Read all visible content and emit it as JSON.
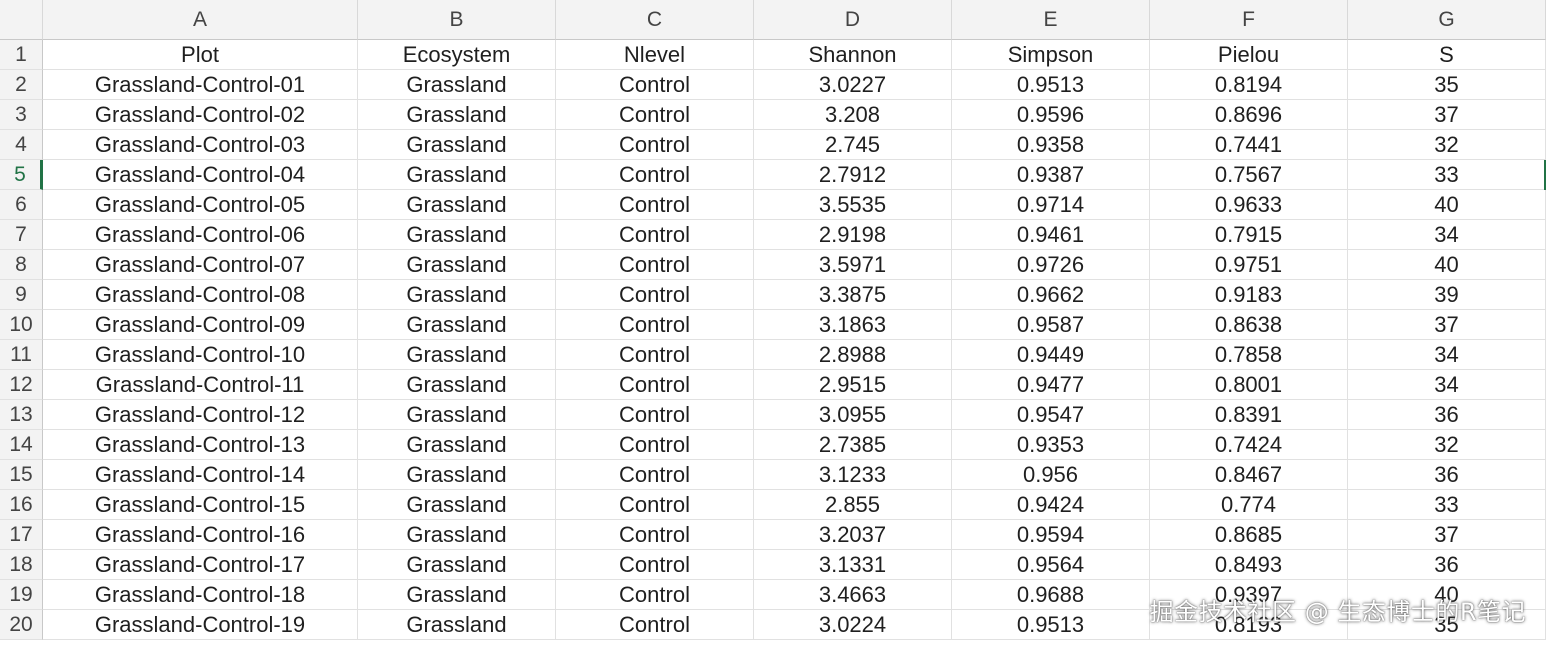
{
  "columns": [
    "A",
    "B",
    "C",
    "D",
    "E",
    "F",
    "G"
  ],
  "row_numbers": [
    "1",
    "2",
    "3",
    "4",
    "5",
    "6",
    "7",
    "8",
    "9",
    "10",
    "11",
    "12",
    "13",
    "14",
    "15",
    "16",
    "17",
    "18",
    "19",
    "20"
  ],
  "headers": [
    "Plot",
    "Ecosystem",
    "Nlevel",
    "Shannon",
    "Simpson",
    "Pielou",
    "S"
  ],
  "rows": [
    [
      "Grassland-Control-01",
      "Grassland",
      "Control",
      "3.0227",
      "0.9513",
      "0.8194",
      "35"
    ],
    [
      "Grassland-Control-02",
      "Grassland",
      "Control",
      "3.208",
      "0.9596",
      "0.8696",
      "37"
    ],
    [
      "Grassland-Control-03",
      "Grassland",
      "Control",
      "2.745",
      "0.9358",
      "0.7441",
      "32"
    ],
    [
      "Grassland-Control-04",
      "Grassland",
      "Control",
      "2.7912",
      "0.9387",
      "0.7567",
      "33"
    ],
    [
      "Grassland-Control-05",
      "Grassland",
      "Control",
      "3.5535",
      "0.9714",
      "0.9633",
      "40"
    ],
    [
      "Grassland-Control-06",
      "Grassland",
      "Control",
      "2.9198",
      "0.9461",
      "0.7915",
      "34"
    ],
    [
      "Grassland-Control-07",
      "Grassland",
      "Control",
      "3.5971",
      "0.9726",
      "0.9751",
      "40"
    ],
    [
      "Grassland-Control-08",
      "Grassland",
      "Control",
      "3.3875",
      "0.9662",
      "0.9183",
      "39"
    ],
    [
      "Grassland-Control-09",
      "Grassland",
      "Control",
      "3.1863",
      "0.9587",
      "0.8638",
      "37"
    ],
    [
      "Grassland-Control-10",
      "Grassland",
      "Control",
      "2.8988",
      "0.9449",
      "0.7858",
      "34"
    ],
    [
      "Grassland-Control-11",
      "Grassland",
      "Control",
      "2.9515",
      "0.9477",
      "0.8001",
      "34"
    ],
    [
      "Grassland-Control-12",
      "Grassland",
      "Control",
      "3.0955",
      "0.9547",
      "0.8391",
      "36"
    ],
    [
      "Grassland-Control-13",
      "Grassland",
      "Control",
      "2.7385",
      "0.9353",
      "0.7424",
      "32"
    ],
    [
      "Grassland-Control-14",
      "Grassland",
      "Control",
      "3.1233",
      "0.956",
      "0.8467",
      "36"
    ],
    [
      "Grassland-Control-15",
      "Grassland",
      "Control",
      "2.855",
      "0.9424",
      "0.774",
      "33"
    ],
    [
      "Grassland-Control-16",
      "Grassland",
      "Control",
      "3.2037",
      "0.9594",
      "0.8685",
      "37"
    ],
    [
      "Grassland-Control-17",
      "Grassland",
      "Control",
      "3.1331",
      "0.9564",
      "0.8493",
      "36"
    ],
    [
      "Grassland-Control-18",
      "Grassland",
      "Control",
      "3.4663",
      "0.9688",
      "0.9397",
      "40"
    ],
    [
      "Grassland-Control-19",
      "Grassland",
      "Control",
      "3.0224",
      "0.9513",
      "0.8193",
      "35"
    ]
  ],
  "active_row": "5",
  "accent_color": "#217346",
  "watermark": "掘金技术社区 @ 生态博士的R笔记"
}
